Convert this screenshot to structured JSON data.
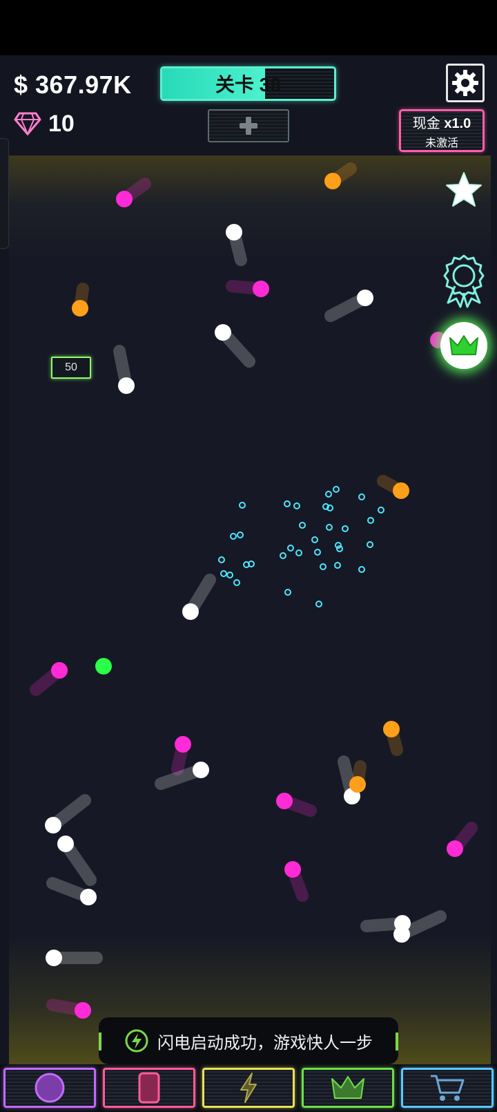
{
  "hud": {
    "money": "$ 367.97K",
    "gems": "10",
    "level_label": "关卡 38",
    "level_progress": 0.6,
    "cash_title": "现金",
    "cash_multiplier": "x1.0",
    "cash_status": "未激活"
  },
  "arena": {
    "brick_value": "50"
  },
  "toast": {
    "message": "闪电启动成功，游戏快人一步"
  },
  "icons": {
    "gem": "gem-icon",
    "plus": "plus-icon",
    "settings": "gear-icon",
    "star": "star-icon",
    "badge": "ribbon-badge-icon",
    "crown": "crown-icon",
    "lightning": "lightning-icon",
    "ball": "ball-icon",
    "card": "card-icon",
    "cart": "cart-icon"
  },
  "colors": {
    "level_accent": "#4df1cf",
    "cash_accent": "#ff5fa8",
    "ball_white": "#ffffff",
    "ball_magenta": "#ff2bd6",
    "ball_orange": "#ff9f1a",
    "ball_green": "#2aff4a",
    "particle_cyan": "#4de8ff",
    "tab_purple": "#c06cff",
    "tab_pink": "#ff5c9a",
    "tab_yellow": "#e8e25a",
    "tab_green": "#6ddf4a",
    "tab_blue": "#5cc8ff"
  }
}
